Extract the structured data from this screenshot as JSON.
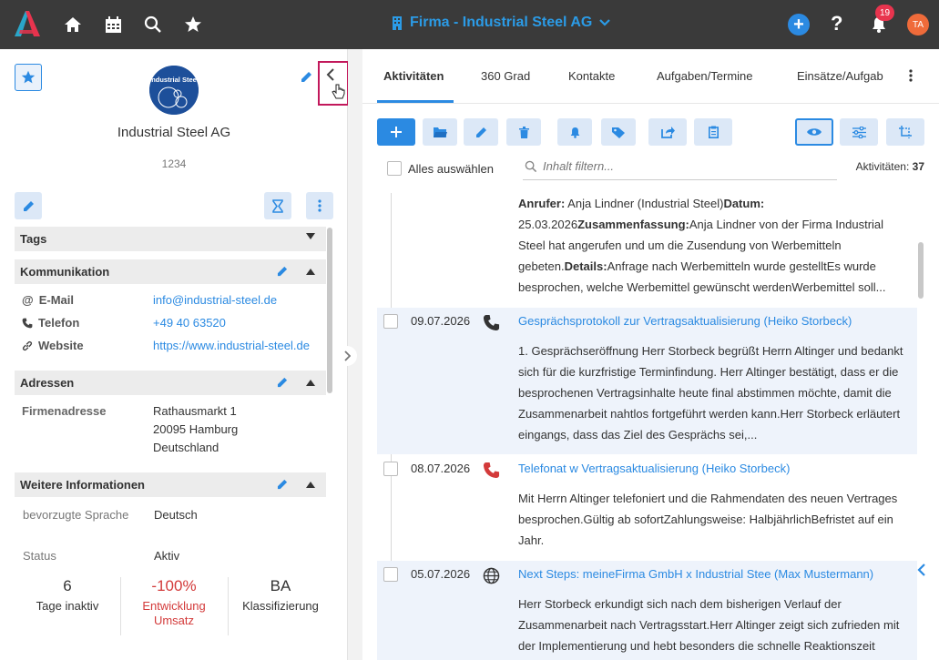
{
  "header": {
    "title": "Firma - Industrial Steel AG",
    "notification_count": "19",
    "avatar_initials": "TA",
    "help_label": "?"
  },
  "company": {
    "logo_text": "Industrial Steel",
    "name": "Industrial Steel AG",
    "number": "1234"
  },
  "sections": {
    "tags": "Tags",
    "kommunikation": "Kommunikation",
    "adressen": "Adressen",
    "weitere": "Weitere Informationen"
  },
  "kommunikation": {
    "email_label": "E-Mail",
    "email_value": "info@industrial-steel.de",
    "phone_label": "Telefon",
    "phone_value": "+49 40 63520",
    "website_label": "Website",
    "website_value": "https://www.industrial-steel.de"
  },
  "adressen": {
    "label": "Firmenadresse",
    "line1": "Rathausmarkt 1",
    "line2": "20095 Hamburg",
    "line3": "Deutschland"
  },
  "weitere": {
    "lang_label": "bevorzugte Sprache",
    "lang_value": "Deutsch",
    "status_label": "Status",
    "status_value": "Aktiv"
  },
  "stats": [
    {
      "value": "6",
      "label": "Tage inaktiv"
    },
    {
      "value": "-100%",
      "label_line1": "Entwicklung",
      "label_line2": "Umsatz"
    },
    {
      "value": "BA",
      "label": "Klassifizierung"
    }
  ],
  "tabs": [
    "Aktivitäten",
    "360 Grad",
    "Kontakte",
    "Aufgaben/Termine",
    "Einsätze/Aufgab"
  ],
  "toolbar": {
    "select_all": "Alles auswählen",
    "filter_placeholder": "Inhalt filtern...",
    "count_label": "Aktivitäten:",
    "count_value": "37"
  },
  "first_activity": {
    "caller_label": "Anrufer:",
    "caller_value": " Anja Lindner (Industrial Steel)",
    "date_label": "Datum:",
    "date_value": "25.03.2026",
    "summary_label": "Zusammenfassung:",
    "summary_value": "Anja Lindner von der Firma Industrial Steel hat angerufen und um die Zusendung von Werbemitteln gebeten.",
    "details_label": "Details:",
    "details_value": "Anfrage nach Werbemitteln wurde gestelltEs wurde besprochen, welche Werbemittel gewünscht werdenWerbemittel soll..."
  },
  "activities": [
    {
      "date": "09.07.2026",
      "icon": "phone-icon",
      "icon_color": "#333333",
      "title": "Gesprächsprotokoll zur Vertragsaktualisierung (Heiko Storbeck)",
      "body": "1. Gesprächseröffnung Herr Storbeck begrüßt Herrn Altinger und bedankt sich für die kurzfristige Terminfindung. Herr Altinger bestätigt, dass er die besprochenen Vertragsinhalte heute final abstimmen möchte, damit die Zusammenarbeit nahtlos fortgeführt werden kann.Herr Storbeck erläutert eingangs, dass das Ziel des Gesprächs sei,..."
    },
    {
      "date": "08.07.2026",
      "icon": "phone-icon",
      "icon_color": "#d33a3a",
      "title": "Telefonat w Vertragsaktualisierung (Heiko Storbeck)",
      "body": "Mit Herrn Altinger telefoniert und die Rahmendaten des neuen Vertrages besprochen.Gültig ab sofortZahlungsweise: HalbjährlichBefristet auf ein Jahr."
    },
    {
      "date": "05.07.2026",
      "icon": "globe-icon",
      "icon_color": "#333333",
      "title": "Next Steps: meineFirma GmbH x Industrial Stee (Max Mustermann)",
      "body": "Herr Storbeck erkundigt sich nach dem bisherigen Verlauf der Zusammenarbeit nach Vertragsstart.Herr Altinger zeigt sich zufrieden mit der Implementierung und hebt besonders die schnelle Reaktionszeit"
    }
  ],
  "colors": {
    "accent": "#2b8ae2",
    "topbar": "#3a3a3a",
    "highlight_row": "#eef3fb",
    "negative": "#d33a3a"
  }
}
